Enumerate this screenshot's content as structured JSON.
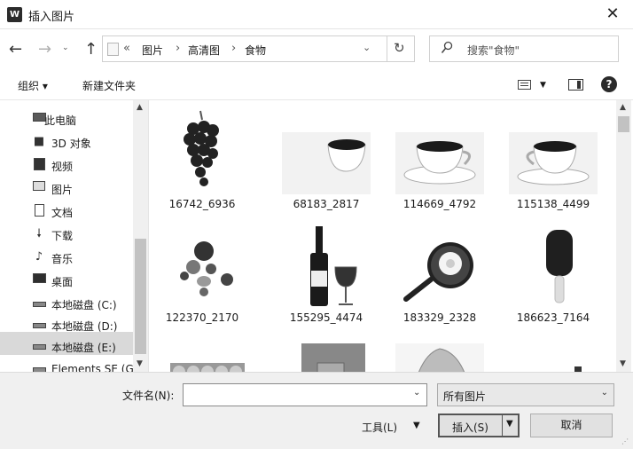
{
  "window": {
    "app_icon": "W",
    "title": "插入图片",
    "close_symbol": "✕"
  },
  "nav": {
    "back_symbol": "←",
    "forward_symbol": "→",
    "recent_symbol": "⌄",
    "up_symbol": "↑",
    "address_prefix": "«",
    "breadcrumbs": [
      "图片",
      "高清图",
      "食物"
    ],
    "separator": "›",
    "dropdown_symbol": "⌄",
    "refresh_symbol": "↻",
    "search_placeholder": "搜索\"食物\""
  },
  "toolbar": {
    "organize_label": "组织 ▾",
    "new_folder_label": "新建文件夹",
    "view_caret": "▼",
    "help_label": "?"
  },
  "sidebar": {
    "scroll_up": "▲",
    "scroll_down": "▼",
    "items": [
      {
        "label": "此电脑",
        "icon": "computer-icon"
      },
      {
        "label": "3D 对象",
        "icon": "cube-icon"
      },
      {
        "label": "视频",
        "icon": "film-icon"
      },
      {
        "label": "图片",
        "icon": "picture-icon"
      },
      {
        "label": "文档",
        "icon": "document-icon"
      },
      {
        "label": "下载",
        "icon": "download-icon"
      },
      {
        "label": "音乐",
        "icon": "music-icon"
      },
      {
        "label": "桌面",
        "icon": "desktop-icon"
      },
      {
        "label": "本地磁盘 (C:)",
        "icon": "drive-icon"
      },
      {
        "label": "本地磁盘 (D:)",
        "icon": "drive-icon"
      },
      {
        "label": "本地磁盘 (E:)",
        "icon": "drive-icon",
        "selected": true
      },
      {
        "label": "Elements SE (G",
        "icon": "drive-icon"
      }
    ]
  },
  "files": [
    {
      "name": "16742_6936",
      "icon": "grapes-thumbnail"
    },
    {
      "name": "68183_2817",
      "icon": "coffee-cup-thumbnail"
    },
    {
      "name": "114669_4792",
      "icon": "coffee-cup-thumbnail"
    },
    {
      "name": "115138_4499",
      "icon": "coffee-cup-thumbnail"
    },
    {
      "name": "122370_2170",
      "icon": "fruit-thumbnail"
    },
    {
      "name": "155295_4474",
      "icon": "wine-thumbnail"
    },
    {
      "name": "183329_2328",
      "icon": "frying-pan-egg-thumbnail"
    },
    {
      "name": "186623_7164",
      "icon": "ice-cream-bar-thumbnail"
    },
    {
      "name": "",
      "icon": "eggs-thumbnail"
    },
    {
      "name": "",
      "icon": "glass-thumbnail"
    },
    {
      "name": "",
      "icon": "eggshell-thumbnail"
    },
    {
      "name": "",
      "icon": "bottle-thumbnail"
    }
  ],
  "content_scroll": {
    "up": "▲",
    "down": "▼"
  },
  "bottom": {
    "filename_label": "文件名(N):",
    "filename_value": "",
    "filename_dropdown": "⌄",
    "filetype_value": "所有图片",
    "filetype_caret": "⌄",
    "tools_label": "工具(L)",
    "tools_caret": "▼",
    "insert_label": "插入(S)",
    "insert_caret": "▼",
    "cancel_label": "取消"
  }
}
